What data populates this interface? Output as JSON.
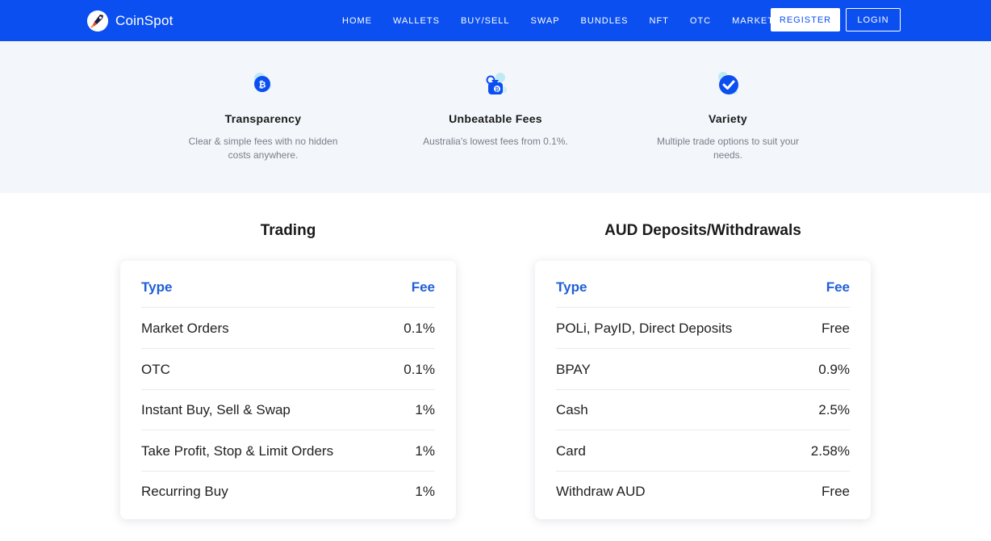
{
  "nav": {
    "brand": "CoinSpot",
    "links": [
      "HOME",
      "WALLETS",
      "BUY/SELL",
      "SWAP",
      "BUNDLES",
      "NFT",
      "OTC",
      "MARKETS"
    ],
    "register_label": "REGISTER",
    "login_label": "LOGIN"
  },
  "colors": {
    "primary": "#0b4ff0",
    "table_header": "#1f5fd6",
    "feature_bg": "#f3f6fb"
  },
  "features": [
    {
      "icon": "bitcoin-coin-icon",
      "title": "Transparency",
      "desc_line1": "Clear & simple fees with no hidden",
      "desc_line2": "costs anywhere."
    },
    {
      "icon": "fee-bag-icon",
      "title": "Unbeatable Fees",
      "desc_line1": "Australia's lowest fees from 0.1%.",
      "desc_line2": ""
    },
    {
      "icon": "checkmark-icon",
      "title": "Variety",
      "desc_line1": "Multiple trade options to suit your",
      "desc_line2": "needs."
    }
  ],
  "trading": {
    "title": "Trading",
    "header_type": "Type",
    "header_fee": "Fee",
    "rows": [
      {
        "type": "Market Orders",
        "fee": "0.1%"
      },
      {
        "type": "OTC",
        "fee": "0.1%"
      },
      {
        "type": "Instant Buy, Sell & Swap",
        "fee": "1%"
      },
      {
        "type": "Take Profit, Stop & Limit Orders",
        "fee": "1%"
      },
      {
        "type": "Recurring Buy",
        "fee": "1%"
      }
    ]
  },
  "aud": {
    "title": "AUD Deposits/Withdrawals",
    "header_type": "Type",
    "header_fee": "Fee",
    "rows": [
      {
        "type": "POLi, PayID, Direct Deposits",
        "fee": "Free"
      },
      {
        "type": "BPAY",
        "fee": "0.9%"
      },
      {
        "type": "Cash",
        "fee": "2.5%"
      },
      {
        "type": "Card",
        "fee": "2.58%"
      },
      {
        "type": "Withdraw AUD",
        "fee": "Free"
      }
    ]
  }
}
